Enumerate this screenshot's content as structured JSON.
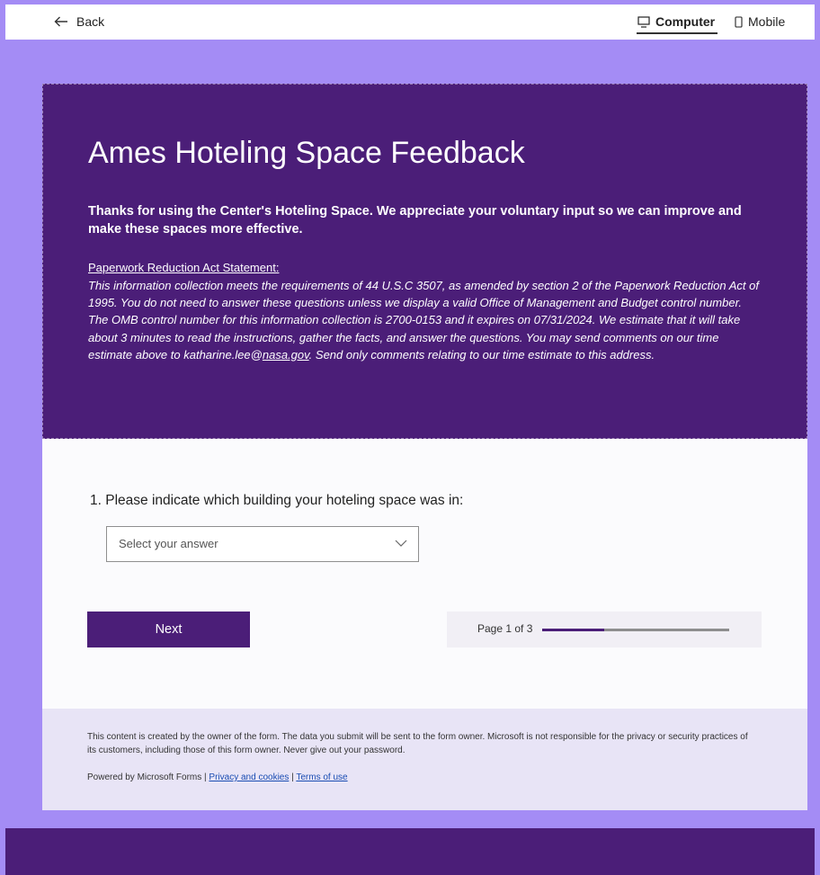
{
  "topbar": {
    "back_label": "Back",
    "computer_label": "Computer",
    "mobile_label": "Mobile"
  },
  "form": {
    "title": "Ames Hoteling Space Feedback",
    "description": "Thanks for using the Center's Hoteling Space. We appreciate your voluntary input so we can improve and make these spaces more effective.",
    "pra_heading": "Paperwork Reduction Act Statement:",
    "pra_text_before_link": "This information collection meets the requirements of 44 U.S.C 3507, as amended by section 2 of the Paperwork Reduction Act of 1995. You do not need to answer these questions unless we display a valid Office of Management and Budget control number. The OMB control number for this information collection is 2700-0153 and it expires on 07/31/2024. We estimate that it will take about 3 minutes to read the instructions, gather the facts, and answer the questions. You may send comments on our time estimate above to katharine.lee@",
    "pra_link": "nasa.gov",
    "pra_text_after_link": ". Send only comments relating to our time estimate to this address."
  },
  "question": {
    "number": "1.",
    "text": "Please indicate which building your hoteling space was in:",
    "placeholder": "Select your answer"
  },
  "navigation": {
    "next_label": "Next",
    "page_indicator": "Page 1 of 3",
    "progress_fraction": 0.333
  },
  "footer": {
    "disclaimer": "This content is created by the owner of the form. The data you submit will be sent to the form owner. Microsoft is not responsible for the privacy or security practices of its customers, including those of this form owner. Never give out your password.",
    "powered_by": "Powered by Microsoft Forms",
    "separator": " | ",
    "privacy_link": "Privacy and cookies",
    "terms_link": "Terms of use"
  },
  "colors": {
    "background": "#a48cf5",
    "header": "#4b1e78",
    "footer": "#e8e4f6",
    "link": "#1a4db3"
  },
  "icons": {
    "back": "arrow-left-icon",
    "computer": "monitor-icon",
    "mobile": "phone-icon",
    "dropdown": "chevron-down-icon"
  }
}
